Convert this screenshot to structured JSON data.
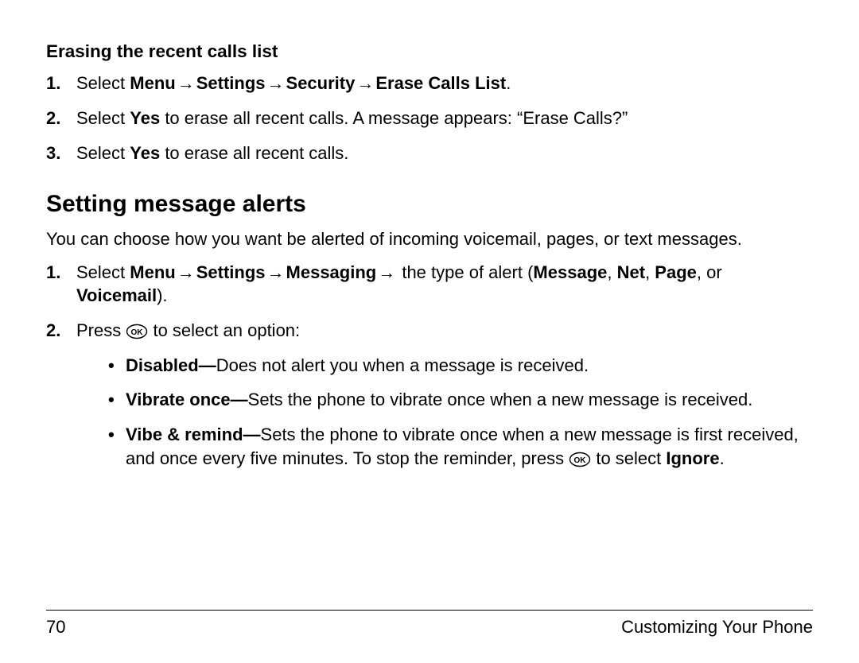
{
  "section1": {
    "heading": "Erasing the recent calls list",
    "steps": {
      "s1_pre": "Select ",
      "s1_menu": "Menu",
      "s1_settings": "Settings",
      "s1_security": "Security",
      "s1_erase": "Erase Calls List",
      "s1_period": ".",
      "s2_pre": "Select ",
      "s2_yes": "Yes",
      "s2_post": " to erase all recent calls. A message appears: “Erase Calls?”",
      "s3_pre": "Select ",
      "s3_yes": "Yes",
      "s3_post": " to erase all recent calls."
    }
  },
  "arrow": "→",
  "section2": {
    "heading": "Setting message alerts",
    "intro": "You can choose how you want be alerted of incoming voicemail, pages, or text messages.",
    "steps": {
      "s1_pre": "Select ",
      "s1_menu": "Menu",
      "s1_settings": "Settings",
      "s1_messaging": "Messaging",
      "s1_mid": " the type of alert (",
      "s1_message": "Message",
      "s1_comma1": ", ",
      "s1_net": "Net",
      "s1_comma2": ", ",
      "s1_page": "Page",
      "s1_or": ", or ",
      "s1_voicemail": "Voicemail",
      "s1_close": ").",
      "s2_pre": "Press ",
      "s2_post": " to select an option:"
    },
    "bullets": {
      "b1_title": "Disabled—",
      "b1_body": "Does not alert you when a message is received.",
      "b2_title": "Vibrate once—",
      "b2_body": "Sets the phone to vibrate once when a new message is received.",
      "b3_title": "Vibe & remind—",
      "b3_body_pre": "Sets the phone to vibrate once when a new message is first received, and once every five minutes. To stop the reminder, press ",
      "b3_body_mid": " to select ",
      "b3_ignore": "Ignore",
      "b3_period": "."
    }
  },
  "footer": {
    "page": "70",
    "label": "Customizing Your Phone"
  }
}
